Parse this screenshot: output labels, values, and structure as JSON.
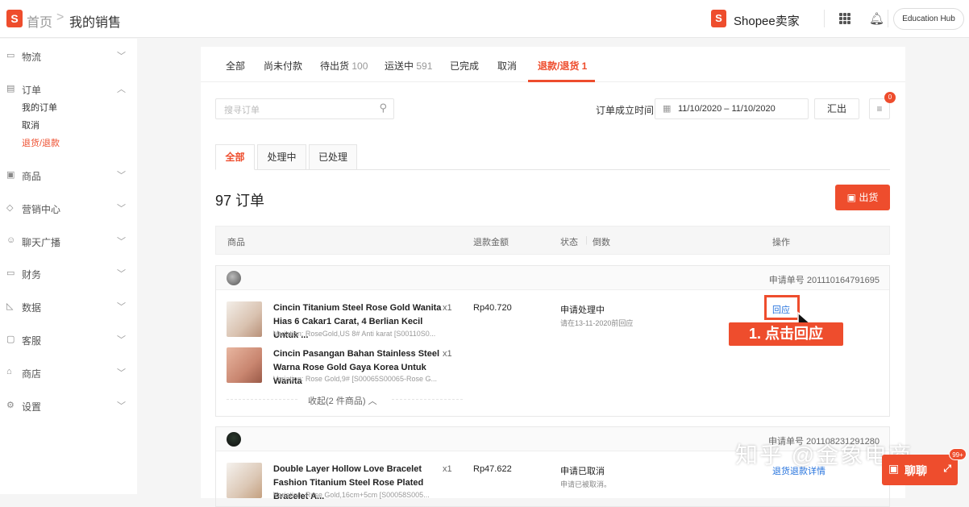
{
  "header": {
    "logo_letter": "S",
    "home": "首页",
    "separator": ">",
    "current": "我的销售",
    "brand": "Shopee卖家",
    "education_hub": "Education Hub"
  },
  "sidebar": {
    "items": [
      {
        "icon": "truck-icon",
        "label": "物流"
      },
      {
        "icon": "order-icon",
        "label": "订单"
      },
      {
        "icon": "product-icon",
        "label": "商品"
      },
      {
        "icon": "tag-icon",
        "label": "营销中心"
      },
      {
        "icon": "chat-icon",
        "label": "聊天广播"
      },
      {
        "icon": "wallet-icon",
        "label": "财务"
      },
      {
        "icon": "chart-icon",
        "label": "数据"
      },
      {
        "icon": "support-icon",
        "label": "客服"
      },
      {
        "icon": "shop-icon",
        "label": "商店"
      },
      {
        "icon": "gear-icon",
        "label": "设置"
      }
    ],
    "order_sub": [
      "我的订单",
      "取消",
      "退货/退款"
    ],
    "active_sub": "退货/退款"
  },
  "tabs": [
    {
      "label": "全部",
      "count": ""
    },
    {
      "label": "尚未付款",
      "count": ""
    },
    {
      "label": "待出货",
      "count": "100"
    },
    {
      "label": "运送中",
      "count": "591"
    },
    {
      "label": "已完成",
      "count": ""
    },
    {
      "label": "取消",
      "count": ""
    },
    {
      "label": "退款/退货 1",
      "count": ""
    }
  ],
  "toolbar": {
    "search_placeholder": "搜寻订单",
    "date_label": "订单成立时间",
    "date_range": "11/10/2020 – 11/10/2020",
    "export": "汇出",
    "badge": "0"
  },
  "subtabs": [
    "全部",
    "处理中",
    "已处理"
  ],
  "summary": {
    "count": "97 订单",
    "ship_button": "出货"
  },
  "table_headers": {
    "product": "商品",
    "refund_amount": "退款金额",
    "status": "状态",
    "countdown": "倒数",
    "action": "操作"
  },
  "orders": [
    {
      "app_no": "申请单号 201110164791695",
      "products": [
        {
          "name": "Cincin Titanium Steel Rose Gold Wanita Hias 6 Cakar1 Carat, 4 Berlian Kecil Untuk ...",
          "variation": "Variation: RoseGold,US 8# Anti karat [S00110S0...",
          "qty": "x1"
        },
        {
          "name": "Cincin Pasangan Bahan Stainless Steel Warna Rose Gold Gaya Korea Untuk Wanita",
          "variation": "Variation: Rose Gold,9# [S00065S00065-Rose G...",
          "qty": "x1"
        }
      ],
      "amount": "Rp40.720",
      "status": "申请处理中",
      "status_sub": "请在13-11-2020前回应",
      "action": "回应",
      "collapse": "收起(2 件商品)"
    },
    {
      "app_no": "申请单号 201108231291280",
      "products": [
        {
          "name": "Double Layer Hollow Love Bracelet Fashion Titanium Steel Rose Plated Bracelet A...",
          "variation": "Variation: Rose Gold,16cm+5cm [S00058S005...",
          "qty": "x1"
        }
      ],
      "amount": "Rp47.622",
      "status": "申请已取消",
      "status_sub": "申请已被取消。",
      "action": "退货退款详情"
    }
  ],
  "annotation": "1. 点击回应",
  "watermark": "知乎 @金象电商",
  "chat": {
    "label": "聊聊",
    "badge": "99+"
  },
  "colors": {
    "accent": "#ee4d2d",
    "link": "#2673dd"
  }
}
